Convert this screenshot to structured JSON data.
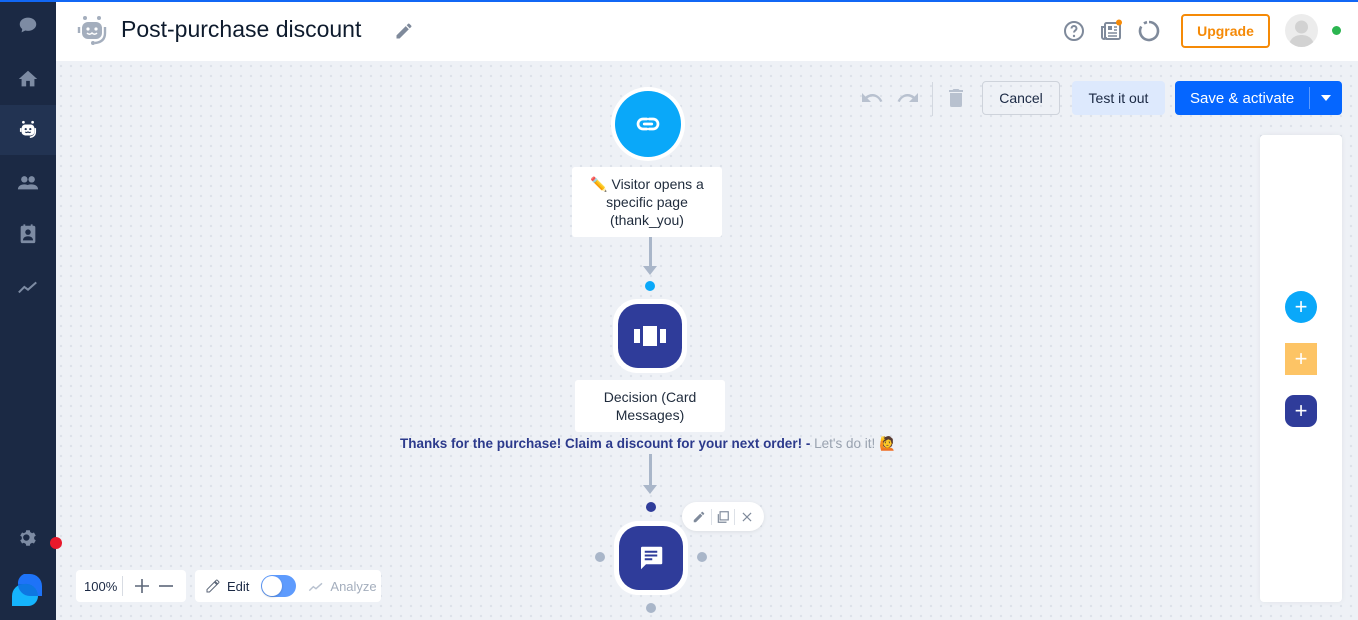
{
  "header": {
    "title": "Post-purchase discount",
    "upgrade_label": "Upgrade",
    "notification_dot_color": "#f58a07",
    "online_status_color": "#2bb550"
  },
  "sidebar": {
    "items": [
      {
        "name": "chat",
        "icon": "chat-bubble-icon",
        "active": false
      },
      {
        "name": "home",
        "icon": "home-icon",
        "active": false
      },
      {
        "name": "chatbots",
        "icon": "bot-icon",
        "active": true
      },
      {
        "name": "customers",
        "icon": "people-icon",
        "active": false
      },
      {
        "name": "contacts",
        "icon": "contact-card-icon",
        "active": false
      },
      {
        "name": "analytics",
        "icon": "trend-line-icon",
        "active": false
      },
      {
        "name": "settings",
        "icon": "gear-icon",
        "active": false
      }
    ]
  },
  "toolbar": {
    "cancel_label": "Cancel",
    "test_label": "Test it out",
    "save_label": "Save & activate"
  },
  "flow": {
    "trigger": {
      "icon": "link-icon",
      "label_emoji": "✏️",
      "label": "Visitor opens a specific page (thank_you)"
    },
    "decision": {
      "icon": "cards-icon",
      "label": "Decision (Card Messages)"
    },
    "choice": {
      "message": "Thanks for the purchase! Claim a discount for your next order! -",
      "answer": "Let's do it!",
      "emoji": "🙋"
    },
    "message_node": {
      "icon": "message-icon"
    }
  },
  "right_panel": {
    "buttons": [
      {
        "name": "add-trigger",
        "color": "#0aa8f9"
      },
      {
        "name": "add-condition",
        "color": "#fdc465"
      },
      {
        "name": "add-action",
        "color": "#2f3c9a"
      }
    ]
  },
  "bottom": {
    "zoom_level": "100%",
    "edit_label": "Edit",
    "analyze_label": "Analyze"
  }
}
